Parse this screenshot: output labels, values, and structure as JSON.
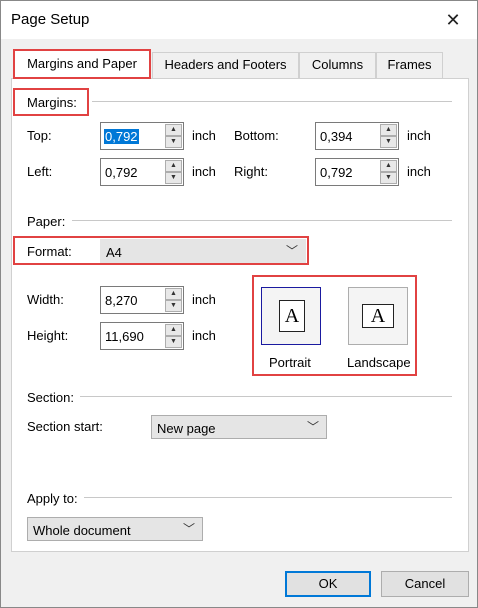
{
  "window": {
    "title": "Page Setup"
  },
  "tabs": [
    {
      "label": "Margins and Paper"
    },
    {
      "label": "Headers and Footers"
    },
    {
      "label": "Columns"
    },
    {
      "label": "Frames"
    }
  ],
  "margins": {
    "heading": "Margins:",
    "top": {
      "label": "Top:",
      "value": "0,792",
      "unit": "inch"
    },
    "bottom": {
      "label": "Bottom:",
      "value": "0,394",
      "unit": "inch"
    },
    "left": {
      "label": "Left:",
      "value": "0,792",
      "unit": "inch"
    },
    "right": {
      "label": "Right:",
      "value": "0,792",
      "unit": "inch"
    }
  },
  "paper": {
    "heading": "Paper:",
    "format_label": "Format:",
    "format_value": "A4",
    "width": {
      "label": "Width:",
      "value": "8,270",
      "unit": "inch"
    },
    "height": {
      "label": "Height:",
      "value": "11,690",
      "unit": "inch"
    },
    "portrait_label": "Portrait",
    "landscape_label": "Landscape",
    "page_glyph": "A"
  },
  "section": {
    "heading": "Section:",
    "start_label": "Section start:",
    "start_value": "New page"
  },
  "apply": {
    "label": "Apply to:",
    "value": "Whole document"
  },
  "buttons": {
    "ok": "OK",
    "cancel": "Cancel"
  },
  "colors": {
    "highlight": "#e14242",
    "accent": "#0078d7"
  }
}
